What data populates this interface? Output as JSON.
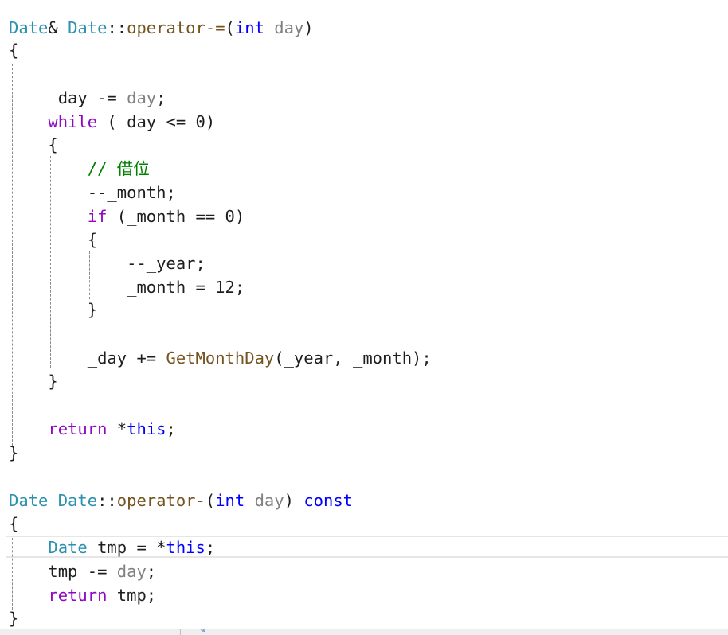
{
  "editor": {
    "language": "C++",
    "colors": {
      "type": "#2b91af",
      "keyword": "#0000ff",
      "control": "#8f08c4",
      "function": "#74531f",
      "parameter": "#808080",
      "comment": "#008000",
      "number": "#098658",
      "text": "#1e1e1e"
    },
    "lines": [
      [
        {
          "c": "type",
          "t": "Date"
        },
        {
          "c": "plain",
          "t": "& "
        },
        {
          "c": "type",
          "t": "Date"
        },
        {
          "c": "plain",
          "t": "::"
        },
        {
          "c": "fn",
          "t": "operator-="
        },
        {
          "c": "plain",
          "t": "("
        },
        {
          "c": "kw",
          "t": "int"
        },
        {
          "c": "plain",
          "t": " "
        },
        {
          "c": "param",
          "t": "day"
        },
        {
          "c": "plain",
          "t": ")"
        }
      ],
      [
        {
          "c": "plain",
          "t": "{"
        }
      ],
      [],
      [
        {
          "c": "plain",
          "t": "    _day -= "
        },
        {
          "c": "param",
          "t": "day"
        },
        {
          "c": "plain",
          "t": ";"
        }
      ],
      [
        {
          "c": "plain",
          "t": "    "
        },
        {
          "c": "ctrl",
          "t": "while"
        },
        {
          "c": "plain",
          "t": " (_day <= 0)"
        }
      ],
      [
        {
          "c": "plain",
          "t": "    {"
        }
      ],
      [
        {
          "c": "plain",
          "t": "        "
        },
        {
          "c": "cmt",
          "t": "// 借位"
        }
      ],
      [
        {
          "c": "plain",
          "t": "        --_month;"
        }
      ],
      [
        {
          "c": "plain",
          "t": "        "
        },
        {
          "c": "ctrl",
          "t": "if"
        },
        {
          "c": "plain",
          "t": " (_month == 0)"
        }
      ],
      [
        {
          "c": "plain",
          "t": "        {"
        }
      ],
      [
        {
          "c": "plain",
          "t": "            --_year;"
        }
      ],
      [
        {
          "c": "plain",
          "t": "            _month = 12;"
        }
      ],
      [
        {
          "c": "plain",
          "t": "        }"
        }
      ],
      [],
      [
        {
          "c": "plain",
          "t": "        _day += "
        },
        {
          "c": "fn",
          "t": "GetMonthDay"
        },
        {
          "c": "plain",
          "t": "(_year, _month);"
        }
      ],
      [
        {
          "c": "plain",
          "t": "    }"
        }
      ],
      [],
      [
        {
          "c": "plain",
          "t": "    "
        },
        {
          "c": "ctrl",
          "t": "return"
        },
        {
          "c": "plain",
          "t": " *"
        },
        {
          "c": "kw",
          "t": "this"
        },
        {
          "c": "plain",
          "t": ";"
        }
      ],
      [
        {
          "c": "plain",
          "t": "}"
        }
      ],
      [],
      [
        {
          "c": "type",
          "t": "Date"
        },
        {
          "c": "plain",
          "t": " "
        },
        {
          "c": "type",
          "t": "Date"
        },
        {
          "c": "plain",
          "t": "::"
        },
        {
          "c": "fn",
          "t": "operator-"
        },
        {
          "c": "plain",
          "t": "("
        },
        {
          "c": "kw",
          "t": "int"
        },
        {
          "c": "plain",
          "t": " "
        },
        {
          "c": "param",
          "t": "day"
        },
        {
          "c": "plain",
          "t": ") "
        },
        {
          "c": "kw",
          "t": "const"
        }
      ],
      [
        {
          "c": "plain",
          "t": "{"
        }
      ],
      [
        {
          "c": "plain",
          "t": "    "
        },
        {
          "c": "type",
          "t": "Date"
        },
        {
          "c": "plain",
          "t": " tmp = *"
        },
        {
          "c": "kw",
          "t": "this"
        },
        {
          "c": "plain",
          "t": ";"
        }
      ],
      [
        {
          "c": "plain",
          "t": "    tmp -= "
        },
        {
          "c": "param",
          "t": "day"
        },
        {
          "c": "plain",
          "t": ";"
        }
      ],
      [
        {
          "c": "plain",
          "t": "    "
        },
        {
          "c": "ctrl",
          "t": "return"
        },
        {
          "c": "plain",
          "t": " tmp;"
        }
      ],
      [
        {
          "c": "plain",
          "t": "}"
        }
      ]
    ]
  },
  "statusbar": {
    "left_text": "",
    "icon": "wrench-icon"
  }
}
